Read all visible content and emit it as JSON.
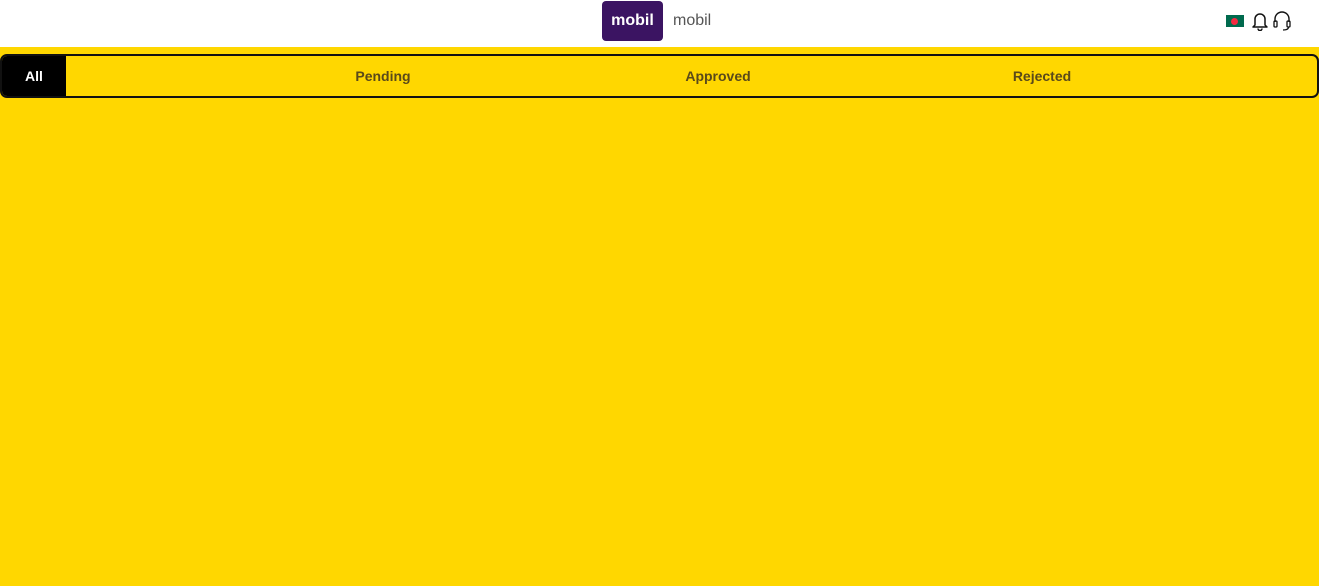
{
  "header": {
    "logo_text": "mobil",
    "brand_name": "mobil",
    "icons": [
      "bangladesh-flag-icon",
      "bell-icon",
      "headset-icon"
    ],
    "logo_color": "#3b1462"
  },
  "tabs": [
    {
      "label": "All",
      "active": true
    },
    {
      "label": "Pending",
      "active": false
    },
    {
      "label": "Approved",
      "active": false
    },
    {
      "label": "Rejected",
      "active": false
    }
  ],
  "colors": {
    "background": "#FFD700",
    "active_tab": "#000000",
    "tab_text": "#5a4a1a"
  }
}
